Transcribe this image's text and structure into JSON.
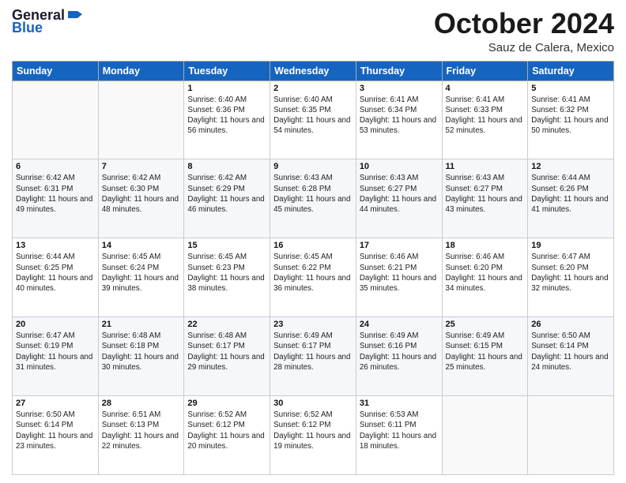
{
  "logo": {
    "general": "General",
    "blue": "Blue"
  },
  "title": "October 2024",
  "location": "Sauz de Calera, Mexico",
  "headers": [
    "Sunday",
    "Monday",
    "Tuesday",
    "Wednesday",
    "Thursday",
    "Friday",
    "Saturday"
  ],
  "weeks": [
    [
      {
        "day": "",
        "info": ""
      },
      {
        "day": "",
        "info": ""
      },
      {
        "day": "1",
        "info": "Sunrise: 6:40 AM\nSunset: 6:36 PM\nDaylight: 11 hours and 56 minutes."
      },
      {
        "day": "2",
        "info": "Sunrise: 6:40 AM\nSunset: 6:35 PM\nDaylight: 11 hours and 54 minutes."
      },
      {
        "day": "3",
        "info": "Sunrise: 6:41 AM\nSunset: 6:34 PM\nDaylight: 11 hours and 53 minutes."
      },
      {
        "day": "4",
        "info": "Sunrise: 6:41 AM\nSunset: 6:33 PM\nDaylight: 11 hours and 52 minutes."
      },
      {
        "day": "5",
        "info": "Sunrise: 6:41 AM\nSunset: 6:32 PM\nDaylight: 11 hours and 50 minutes."
      }
    ],
    [
      {
        "day": "6",
        "info": "Sunrise: 6:42 AM\nSunset: 6:31 PM\nDaylight: 11 hours and 49 minutes."
      },
      {
        "day": "7",
        "info": "Sunrise: 6:42 AM\nSunset: 6:30 PM\nDaylight: 11 hours and 48 minutes."
      },
      {
        "day": "8",
        "info": "Sunrise: 6:42 AM\nSunset: 6:29 PM\nDaylight: 11 hours and 46 minutes."
      },
      {
        "day": "9",
        "info": "Sunrise: 6:43 AM\nSunset: 6:28 PM\nDaylight: 11 hours and 45 minutes."
      },
      {
        "day": "10",
        "info": "Sunrise: 6:43 AM\nSunset: 6:27 PM\nDaylight: 11 hours and 44 minutes."
      },
      {
        "day": "11",
        "info": "Sunrise: 6:43 AM\nSunset: 6:27 PM\nDaylight: 11 hours and 43 minutes."
      },
      {
        "day": "12",
        "info": "Sunrise: 6:44 AM\nSunset: 6:26 PM\nDaylight: 11 hours and 41 minutes."
      }
    ],
    [
      {
        "day": "13",
        "info": "Sunrise: 6:44 AM\nSunset: 6:25 PM\nDaylight: 11 hours and 40 minutes."
      },
      {
        "day": "14",
        "info": "Sunrise: 6:45 AM\nSunset: 6:24 PM\nDaylight: 11 hours and 39 minutes."
      },
      {
        "day": "15",
        "info": "Sunrise: 6:45 AM\nSunset: 6:23 PM\nDaylight: 11 hours and 38 minutes."
      },
      {
        "day": "16",
        "info": "Sunrise: 6:45 AM\nSunset: 6:22 PM\nDaylight: 11 hours and 36 minutes."
      },
      {
        "day": "17",
        "info": "Sunrise: 6:46 AM\nSunset: 6:21 PM\nDaylight: 11 hours and 35 minutes."
      },
      {
        "day": "18",
        "info": "Sunrise: 6:46 AM\nSunset: 6:20 PM\nDaylight: 11 hours and 34 minutes."
      },
      {
        "day": "19",
        "info": "Sunrise: 6:47 AM\nSunset: 6:20 PM\nDaylight: 11 hours and 32 minutes."
      }
    ],
    [
      {
        "day": "20",
        "info": "Sunrise: 6:47 AM\nSunset: 6:19 PM\nDaylight: 11 hours and 31 minutes."
      },
      {
        "day": "21",
        "info": "Sunrise: 6:48 AM\nSunset: 6:18 PM\nDaylight: 11 hours and 30 minutes."
      },
      {
        "day": "22",
        "info": "Sunrise: 6:48 AM\nSunset: 6:17 PM\nDaylight: 11 hours and 29 minutes."
      },
      {
        "day": "23",
        "info": "Sunrise: 6:49 AM\nSunset: 6:17 PM\nDaylight: 11 hours and 28 minutes."
      },
      {
        "day": "24",
        "info": "Sunrise: 6:49 AM\nSunset: 6:16 PM\nDaylight: 11 hours and 26 minutes."
      },
      {
        "day": "25",
        "info": "Sunrise: 6:49 AM\nSunset: 6:15 PM\nDaylight: 11 hours and 25 minutes."
      },
      {
        "day": "26",
        "info": "Sunrise: 6:50 AM\nSunset: 6:14 PM\nDaylight: 11 hours and 24 minutes."
      }
    ],
    [
      {
        "day": "27",
        "info": "Sunrise: 6:50 AM\nSunset: 6:14 PM\nDaylight: 11 hours and 23 minutes."
      },
      {
        "day": "28",
        "info": "Sunrise: 6:51 AM\nSunset: 6:13 PM\nDaylight: 11 hours and 22 minutes."
      },
      {
        "day": "29",
        "info": "Sunrise: 6:52 AM\nSunset: 6:12 PM\nDaylight: 11 hours and 20 minutes."
      },
      {
        "day": "30",
        "info": "Sunrise: 6:52 AM\nSunset: 6:12 PM\nDaylight: 11 hours and 19 minutes."
      },
      {
        "day": "31",
        "info": "Sunrise: 6:53 AM\nSunset: 6:11 PM\nDaylight: 11 hours and 18 minutes."
      },
      {
        "day": "",
        "info": ""
      },
      {
        "day": "",
        "info": ""
      }
    ]
  ]
}
